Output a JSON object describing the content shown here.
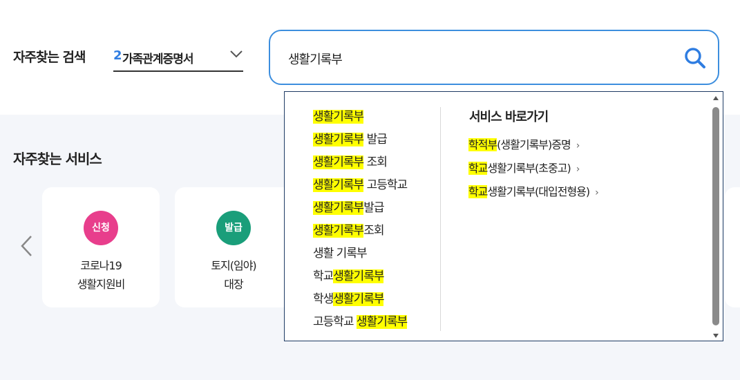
{
  "colors": {
    "accent": "#2f7de1",
    "highlight": "#ffff00",
    "badge_apply": "#e83e8c",
    "badge_issue": "#1a9e7a",
    "search_border": "#3c8ede",
    "dropdown_border": "#1d3a63"
  },
  "frequent_search": {
    "label": "자주찾는 검색",
    "selected_number": "2",
    "selected_text": "가족관계증명서"
  },
  "search": {
    "value": "생활기록부",
    "button_icon": "search-icon"
  },
  "autocomplete": {
    "suggestions": [
      {
        "pre": "",
        "hl": "생활기록부",
        "post": ""
      },
      {
        "pre": "",
        "hl": "생활기록부",
        "post": " 발급"
      },
      {
        "pre": "",
        "hl": "생활기록부",
        "post": " 조회"
      },
      {
        "pre": "",
        "hl": "생활기록부",
        "post": " 고등학교"
      },
      {
        "pre": "",
        "hl": "생활기록부",
        "post": "발급"
      },
      {
        "pre": "",
        "hl": "생활기록부",
        "post": "조회"
      },
      {
        "pre": "생활 기록부",
        "hl": "",
        "post": ""
      },
      {
        "pre": "학교",
        "hl": "생활기록부",
        "post": ""
      },
      {
        "pre": "학생",
        "hl": "생활기록부",
        "post": ""
      },
      {
        "pre": "고등학교 ",
        "hl": "생활기록부",
        "post": ""
      }
    ],
    "shortcut_title": "서비스 바로가기",
    "shortcuts": [
      {
        "hl": "학적부",
        "post": "(생활기록부)증명"
      },
      {
        "hl": "학교",
        "post": "생활기록부(초중고)"
      },
      {
        "hl": "학교",
        "post": "생활기록부(대입전형용)"
      }
    ],
    "shortcut_arrow": "›"
  },
  "frequent_services": {
    "title": "자주찾는 서비스",
    "prev_icon": "chevron-left-icon",
    "cards": [
      {
        "badge": "신청",
        "line1": "코로나19",
        "line2": "생활지원비"
      },
      {
        "badge": "발급",
        "line1": "토지(임야)",
        "line2": "대장"
      }
    ]
  }
}
